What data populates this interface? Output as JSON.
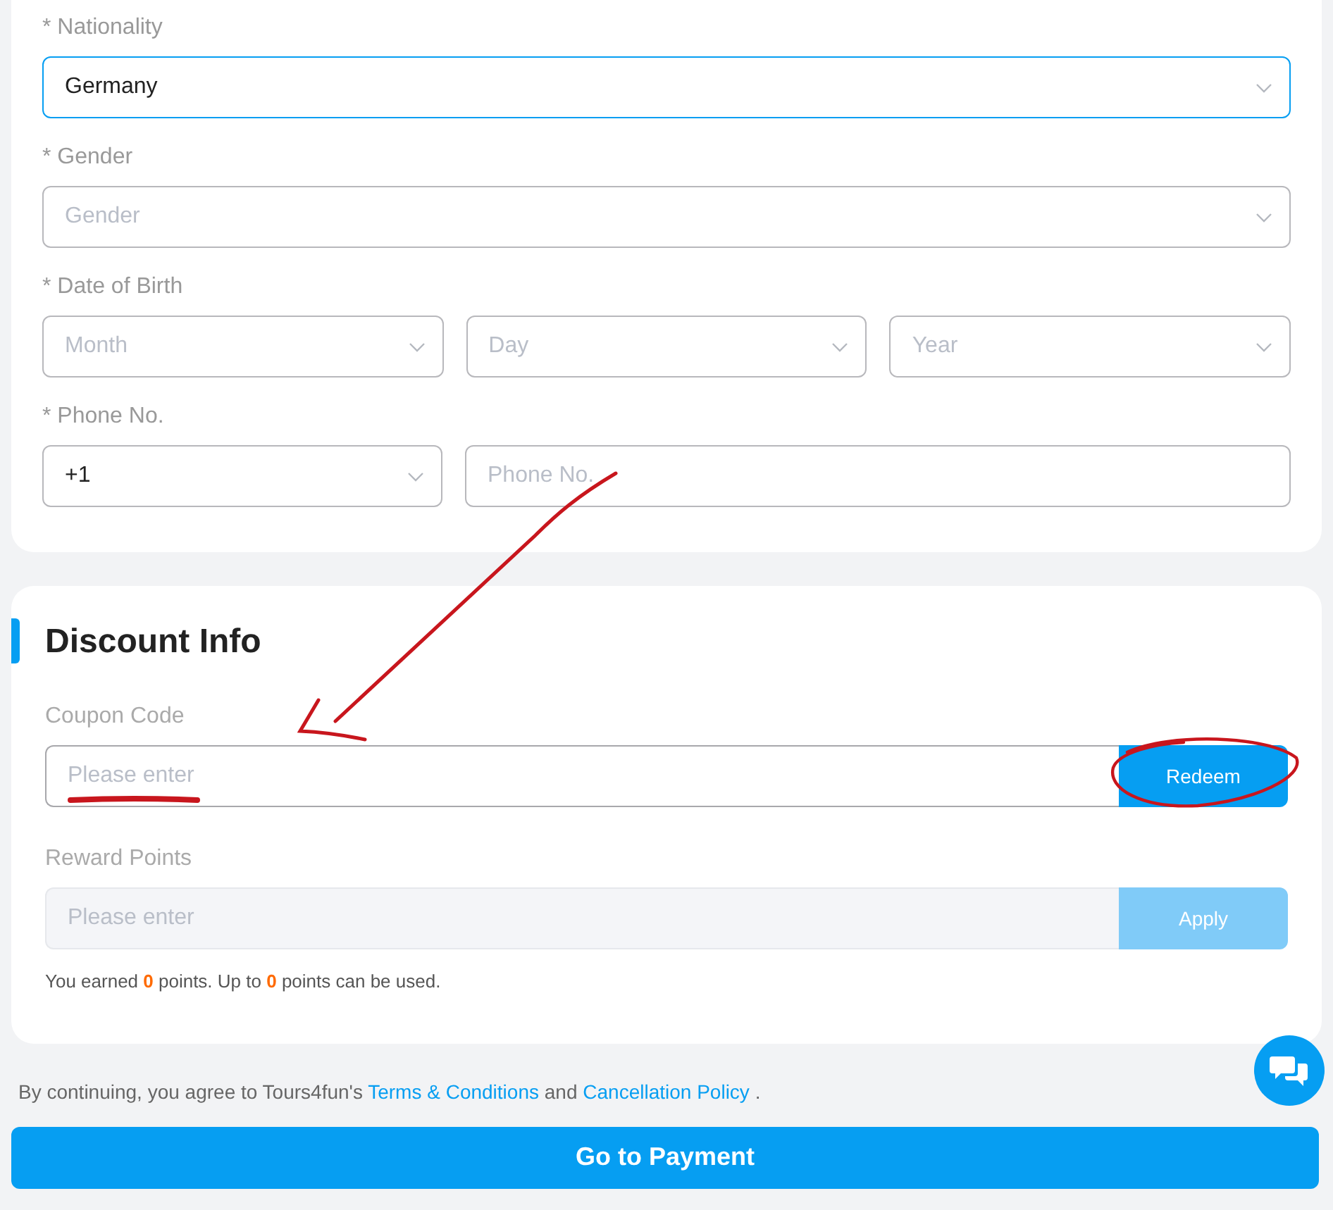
{
  "traveler_form": {
    "fields": [
      {
        "label": "* Nationality",
        "kind": "select",
        "value": "Germany",
        "focused": true
      },
      {
        "label": "* Gender",
        "kind": "select",
        "placeholder": "Gender",
        "focused": false
      },
      {
        "label": "* Date of Birth",
        "kind": "select_group",
        "selects": [
          {
            "placeholder": "Month"
          },
          {
            "placeholder": "Day"
          },
          {
            "placeholder": "Year"
          }
        ]
      },
      {
        "label": "* Phone No.",
        "kind": "phone",
        "code": "+1",
        "phone_placeholder": "Phone No."
      }
    ]
  },
  "discount_info": {
    "title": "Discount Info",
    "inputs": [
      {
        "label": "Coupon Code",
        "placeholder": "Please enter",
        "button": "Redeem",
        "disabled": false
      },
      {
        "label": "Reward Points",
        "placeholder": "Please enter",
        "button": "Apply",
        "disabled": true
      }
    ],
    "note": "You earned **0** points. Up to **0** points can be used."
  },
  "agreement": {
    "text": "By continuing, you agree to Tours4fun's",
    "links": [
      "Terms & Conditions",
      "Cancellation Policy"
    ],
    "joiner": "and",
    "end": "."
  },
  "submit_button": "Go to Payment",
  "annotations": [
    {
      "kind": "arrow"
    },
    {
      "kind": "underline"
    },
    {
      "kind": "circle"
    }
  ]
}
